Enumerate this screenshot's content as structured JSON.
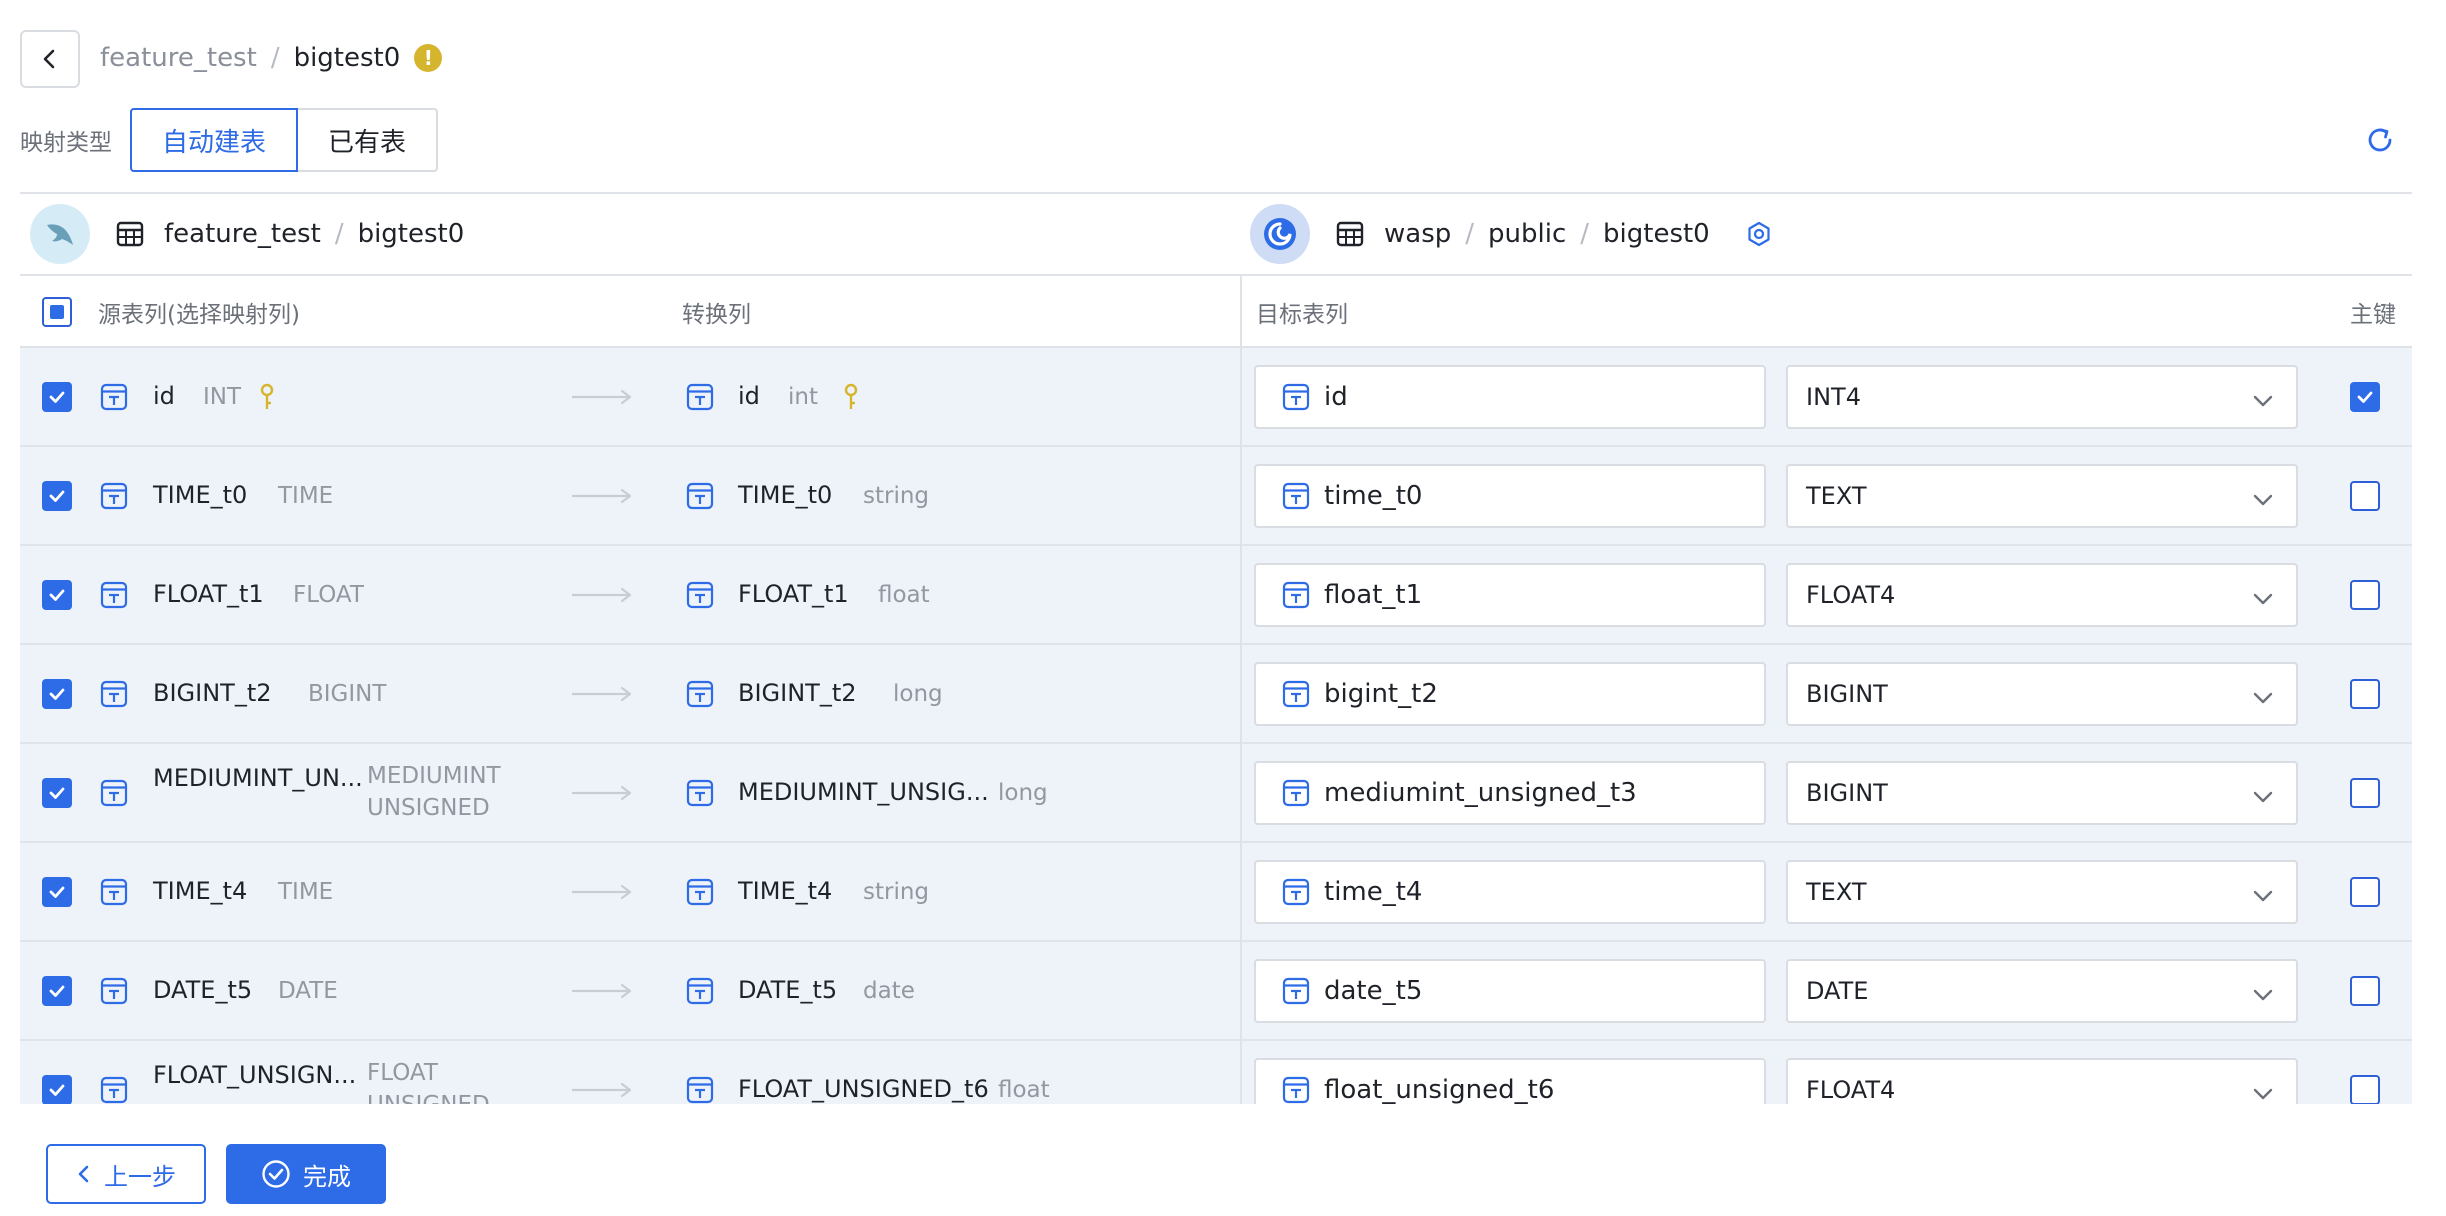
{
  "header": {
    "breadcrumb_db": "feature_test",
    "breadcrumb_sep": "/",
    "breadcrumb_table": "bigtest0",
    "warning_glyph": "!"
  },
  "mapping": {
    "label": "映射类型",
    "auto_create": "自动建表",
    "existing": "已有表"
  },
  "source": {
    "db": "feature_test",
    "table": "bigtest0"
  },
  "target": {
    "db": "wasp",
    "schema": "public",
    "table": "bigtest0"
  },
  "columns_header": {
    "source_columns": "源表列(选择映射列)",
    "transform_columns": "转换列",
    "target_columns": "目标表列",
    "primary_key": "主键"
  },
  "rows": [
    {
      "src_name": "id",
      "src_type": "INT",
      "src_key": true,
      "tr_name": "id",
      "tr_type": "int",
      "tr_key": true,
      "tgt_name": "id",
      "tgt_type": "INT4",
      "pk": true
    },
    {
      "src_name": "TIME_t0",
      "src_type": "TIME",
      "tr_name": "TIME_t0",
      "tr_type": "string",
      "tgt_name": "time_t0",
      "tgt_type": "TEXT",
      "pk": false
    },
    {
      "src_name": "FLOAT_t1",
      "src_type": "FLOAT",
      "tr_name": "FLOAT_t1",
      "tr_type": "float",
      "tgt_name": "float_t1",
      "tgt_type": "FLOAT4",
      "pk": false
    },
    {
      "src_name": "BIGINT_t2",
      "src_type": "BIGINT",
      "tr_name": "BIGINT_t2",
      "tr_type": "long",
      "tgt_name": "bigint_t2",
      "tgt_type": "BIGINT",
      "pk": false
    },
    {
      "src_name": "MEDIUMINT_UN...",
      "src_type_line1": "MEDIUMINT",
      "src_type_line2": "UNSIGNED",
      "tr_name": "MEDIUMINT_UNSIG...",
      "tr_type": "long",
      "tgt_name": "mediumint_unsigned_t3",
      "tgt_type": "BIGINT",
      "pk": false
    },
    {
      "src_name": "TIME_t4",
      "src_type": "TIME",
      "tr_name": "TIME_t4",
      "tr_type": "string",
      "tgt_name": "time_t4",
      "tgt_type": "TEXT",
      "pk": false
    },
    {
      "src_name": "DATE_t5",
      "src_type": "DATE",
      "tr_name": "DATE_t5",
      "tr_type": "date",
      "tgt_name": "date_t5",
      "tgt_type": "DATE",
      "pk": false
    },
    {
      "src_name": "FLOAT_UNSIGN...",
      "src_type_line1": "FLOAT",
      "src_type_line2": "UNSIGNED",
      "tr_name": "FLOAT_UNSIGNED_t6",
      "tr_type": "float",
      "tgt_name": "float_unsigned_t6",
      "tgt_type": "FLOAT4",
      "pk": false
    }
  ],
  "footer": {
    "prev_label": "上一步",
    "done_label": "完成"
  },
  "colors": {
    "primary": "#2e6be6",
    "row_bg": "#eef3fa",
    "border": "#d9dce1",
    "warning": "#d6b52e",
    "key_icon": "#d6b52e"
  }
}
